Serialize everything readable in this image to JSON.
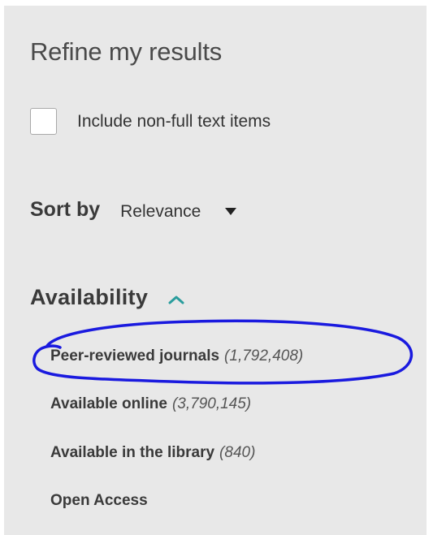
{
  "panel": {
    "title": "Refine my results",
    "include_non_full_text": {
      "label": "Include non-full text items",
      "checked": false
    },
    "sort": {
      "label": "Sort by",
      "selected": "Relevance"
    },
    "availability": {
      "heading": "Availability",
      "items": [
        {
          "label": "Peer-reviewed journals",
          "count": "(1,792,408)"
        },
        {
          "label": "Available online",
          "count": "(3,790,145)"
        },
        {
          "label": "Available in the library",
          "count": "(840)"
        },
        {
          "label": "Open Access",
          "count": ""
        }
      ]
    }
  },
  "colors": {
    "panel_background": "#e8e8e8",
    "accent_chevron": "#2a9d9d",
    "annotation_ink": "#1a1adf"
  },
  "icons": {
    "sort_dropdown": "caret-down-icon",
    "availability_toggle": "chevron-up-icon"
  }
}
